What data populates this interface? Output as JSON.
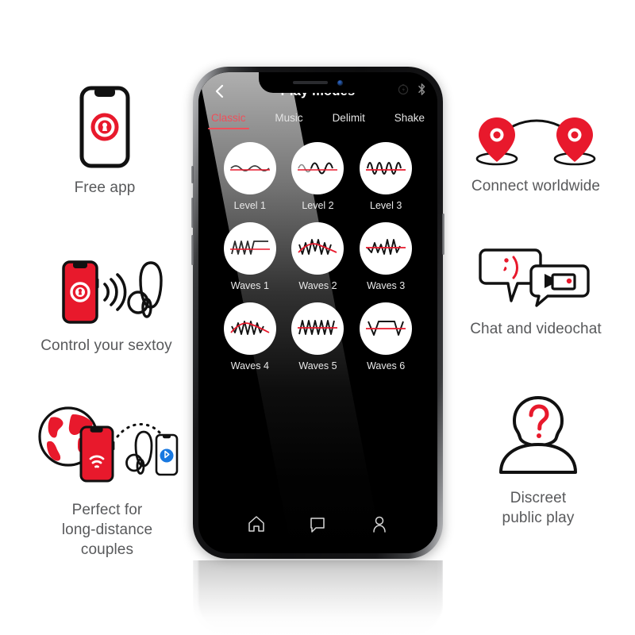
{
  "brand": {
    "red": "#E8192C",
    "accent_pink": "#EF4F5A",
    "text_gray": "#58595B"
  },
  "features": {
    "left": [
      {
        "id": "free-app",
        "caption": "Free app",
        "icon": "phone-with-lock-logo-icon"
      },
      {
        "id": "control-sextoy",
        "caption": "Control your sextoy",
        "icon": "phone-signal-toy-icon"
      },
      {
        "id": "long-distance",
        "caption": "Perfect for\nlong-distance\ncouples",
        "icon": "globe-phone-bluetooth-toy-icon"
      }
    ],
    "right": [
      {
        "id": "connect-worldwide",
        "caption": "Connect worldwide",
        "icon": "two-map-pins-arc-icon"
      },
      {
        "id": "chat-videochat",
        "caption": "Chat and videochat",
        "icon": "speech-bubble-videocam-icon"
      },
      {
        "id": "discreet-public-play",
        "caption": "Discreet\npublic play",
        "icon": "anonymous-person-question-icon"
      }
    ]
  },
  "phone": {
    "app": {
      "header": {
        "title": "Play modes",
        "back_icon": "chevron-left-icon"
      },
      "status_icons": [
        "battery-circle-icon",
        "bluetooth-icon"
      ],
      "tabs": [
        {
          "label": "Classic",
          "active": true
        },
        {
          "label": "Music",
          "active": false
        },
        {
          "label": "Delimit",
          "active": false
        },
        {
          "label": "Shake",
          "active": false
        }
      ],
      "modes": [
        {
          "label": "Level 1",
          "wave": "sine-low"
        },
        {
          "label": "Level 2",
          "wave": "sine-medium"
        },
        {
          "label": "Level 3",
          "wave": "sine-high"
        },
        {
          "label": "Waves 1",
          "wave": "zigzag-plateau"
        },
        {
          "label": "Waves 2",
          "wave": "zigzag-arc"
        },
        {
          "label": "Waves 3",
          "wave": "zigzag-rising"
        },
        {
          "label": "Waves 4",
          "wave": "zigzag-dome"
        },
        {
          "label": "Waves 5",
          "wave": "sawtooth"
        },
        {
          "label": "Waves 6",
          "wave": "v-trapezoid-v"
        }
      ],
      "navbar": [
        {
          "icon": "home-icon",
          "name": "nav-home"
        },
        {
          "icon": "chat-bubble-icon",
          "name": "nav-chat"
        },
        {
          "icon": "profile-icon",
          "name": "nav-profile"
        }
      ]
    }
  }
}
